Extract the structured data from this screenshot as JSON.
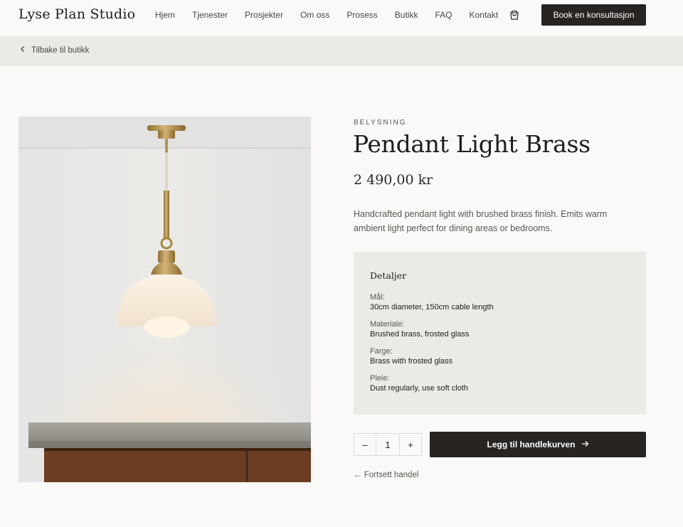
{
  "header": {
    "logo": "Lyse Plan Studio",
    "nav": [
      "Hjem",
      "Tjenester",
      "Prosjekter",
      "Om oss",
      "Prosess",
      "Butikk",
      "FAQ",
      "Kontakt"
    ],
    "cart_icon": "shopping-bag-icon",
    "cta": "Book en konsultasjon"
  },
  "breadcrumb": {
    "back_label": "Tilbake til butikk"
  },
  "product": {
    "category": "BELYSNING",
    "title": "Pendant Light Brass",
    "price": "2 490,00 kr",
    "description": "Handcrafted pendant light with brushed brass finish. Emits warm ambient light perfect for dining areas or bedrooms.",
    "details_title": "Detaljer",
    "details": [
      {
        "label": "Mål:",
        "value": "30cm diameter, 150cm cable length"
      },
      {
        "label": "Materiale:",
        "value": "Brushed brass, frosted glass"
      },
      {
        "label": "Farge:",
        "value": "Brass with frosted glass"
      },
      {
        "label": "Pleie:",
        "value": "Dust regularly, use soft cloth"
      }
    ]
  },
  "cart": {
    "minus": "–",
    "quantity": "1",
    "plus": "+",
    "add_label": "Legg til handlekurven",
    "continue_label": "← Fortsett handel"
  },
  "colors": {
    "background": "#faf9f7",
    "panel": "#eceae5",
    "dark": "#272422",
    "brass": "#b8964e"
  }
}
